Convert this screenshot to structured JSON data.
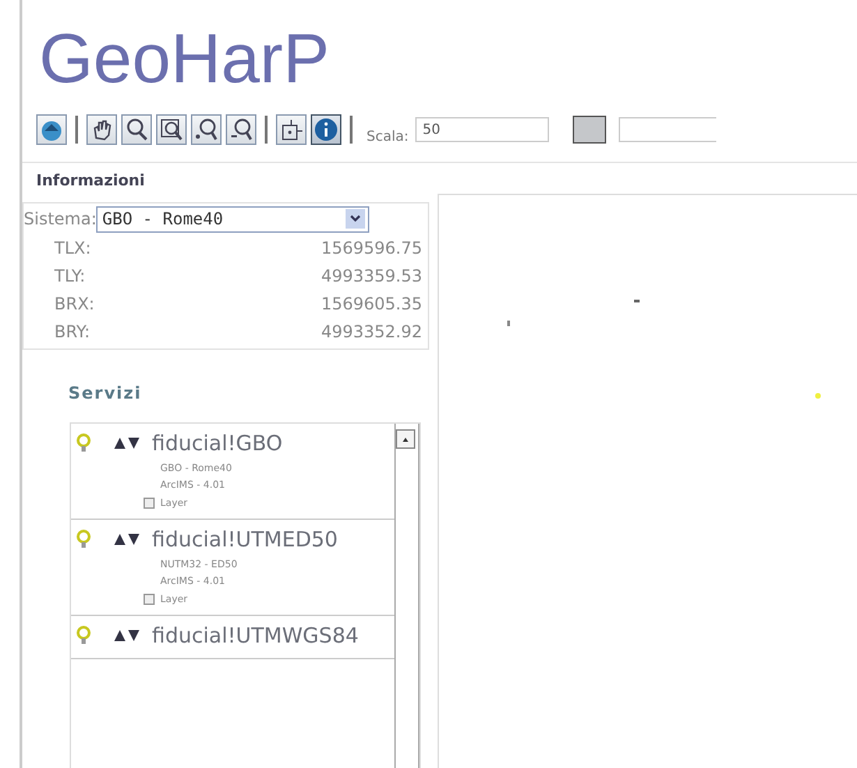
{
  "app_title": "GeoHarP",
  "toolbar": {
    "tools": [
      {
        "kind": "home",
        "selected": false
      },
      {
        "kind": "sep"
      },
      {
        "kind": "pan",
        "selected": false
      },
      {
        "kind": "zoom",
        "selected": false
      },
      {
        "kind": "zoombox",
        "selected": false
      },
      {
        "kind": "zoomin",
        "selected": false
      },
      {
        "kind": "zoomout",
        "selected": false
      },
      {
        "kind": "sep"
      },
      {
        "kind": "extent",
        "selected": false
      },
      {
        "kind": "info",
        "selected": true
      },
      {
        "kind": "sep"
      }
    ],
    "scale_label": "Scala:",
    "scale_value": "50"
  },
  "info": {
    "heading": "Informazioni",
    "system_label": "Sistema:",
    "system_value": "GBO - Rome40",
    "rows": [
      {
        "label": "TLX:",
        "value": "1569596.75"
      },
      {
        "label": "TLY:",
        "value": "4993359.53"
      },
      {
        "label": "BRX:",
        "value": "1569605.35"
      },
      {
        "label": "BRY:",
        "value": "4993352.92"
      }
    ]
  },
  "services": {
    "heading": "Servizi",
    "items": [
      {
        "name": "fiducial!GBO",
        "lines": [
          "GBO - Rome40",
          "ArcIMS - 4.01"
        ],
        "layer": "Layer",
        "expanded": false
      },
      {
        "name": "fiducial!UTMED50",
        "lines": [
          "NUTM32 - ED50",
          "ArcIMS - 4.01"
        ],
        "layer": "Layer",
        "expanded": false
      },
      {
        "name": "fiducial!UTMWGS84"
      }
    ]
  }
}
